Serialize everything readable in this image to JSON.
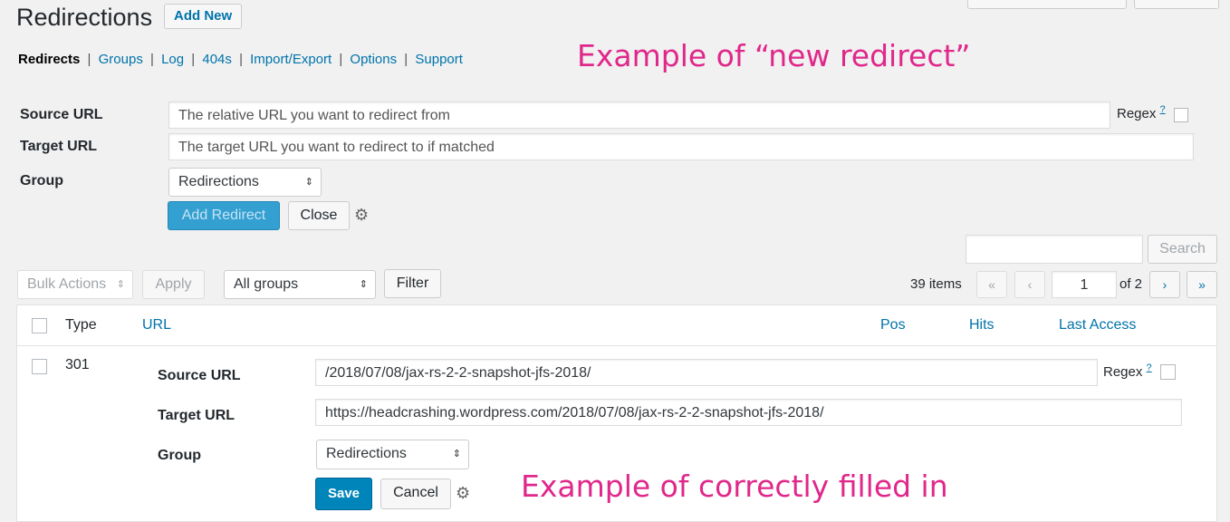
{
  "header": {
    "title": "Redirections",
    "add_new": "Add New"
  },
  "subnav": {
    "current": "Redirects",
    "links": [
      "Groups",
      "Log",
      "404s",
      "Import/Export",
      "Options",
      "Support"
    ],
    "separator": "|"
  },
  "annotations": {
    "top_note": "Example of “new redirect”",
    "bottom_note": "Example of correctly filled in",
    "color": "#e0288b"
  },
  "new_redirect_form": {
    "source_label": "Source URL",
    "source_placeholder": "The relative URL you want to redirect from",
    "regex_label": "Regex",
    "regex_help": "?",
    "target_label": "Target URL",
    "target_placeholder": "The target URL you want to redirect to if matched",
    "group_label": "Group",
    "group_value": "Redirections",
    "add_button": "Add Redirect",
    "close_button": "Close",
    "options_icon": "gear-icon"
  },
  "search": {
    "value": "",
    "button": "Search"
  },
  "tablenav": {
    "bulk_actions": "Bulk Actions",
    "apply": "Apply",
    "group_filter": "All groups",
    "filter_button": "Filter",
    "items_count": "39 items",
    "first_page": "«",
    "prev_page": "‹",
    "current_page": "1",
    "of_pages": "of 2",
    "next_page": "›",
    "last_page": "»"
  },
  "table": {
    "columns": {
      "type": "Type",
      "url": "URL",
      "pos": "Pos",
      "hits": "Hits",
      "last_access": "Last Access"
    },
    "edit_row": {
      "type": "301",
      "source_label": "Source URL",
      "source_value": "/2018/07/08/jax-rs-2-2-snapshot-jfs-2018/",
      "regex_label": "Regex",
      "regex_help": "?",
      "target_label": "Target URL",
      "target_value": "https://headcrashing.wordpress.com/2018/07/08/jax-rs-2-2-snapshot-jfs-2018/",
      "group_label": "Group",
      "group_value": "Redirections",
      "save_button": "Save",
      "cancel_button": "Cancel",
      "options_icon": "gear-icon"
    }
  },
  "colors": {
    "link": "#0073aa",
    "primary": "#0085ba",
    "background": "#f1f1f1"
  }
}
